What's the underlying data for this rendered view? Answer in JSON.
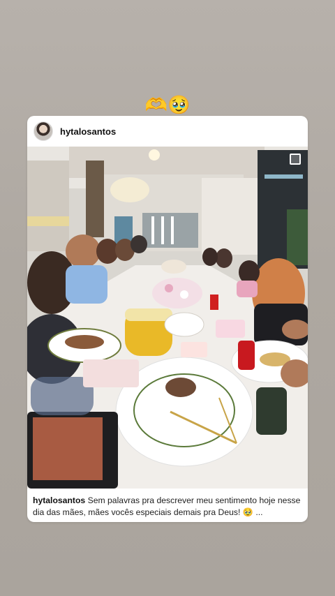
{
  "reaction_emojis": "🫶🥹",
  "post": {
    "username": "hytalosantos",
    "caption_user": "hytalosantos",
    "caption_text": "Sem palavras pra descrever meu sentimento hoje nesse dia das mães, mães vocês especiais demais pra Deus! 🥹 ..."
  },
  "colors": {
    "background": "#b0aaa3",
    "card": "#ffffff",
    "text": "#222222"
  }
}
